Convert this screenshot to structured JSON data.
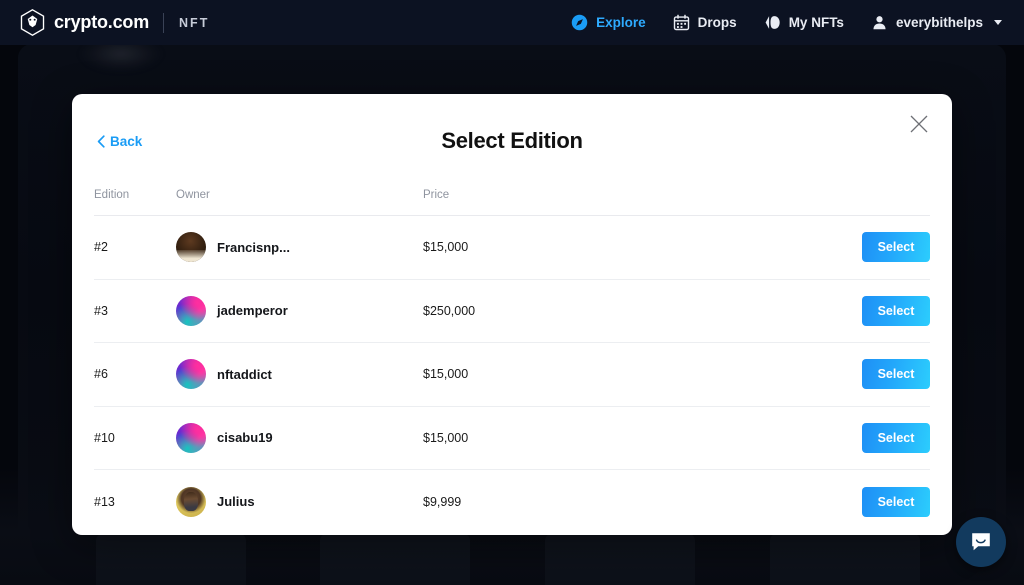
{
  "topnav": {
    "brand": {
      "name": "crypto.com",
      "sub": "NFT",
      "logo_icon": "crypto-com-logo-icon"
    },
    "items": [
      {
        "label": "Explore",
        "icon": "compass-icon",
        "active": true
      },
      {
        "label": "Drops",
        "icon": "calendar-icon",
        "active": false
      },
      {
        "label": "My NFTs",
        "icon": "cards-icon",
        "active": false
      }
    ],
    "user": {
      "label": "everybithelps",
      "icon": "person-icon",
      "caret": "chevron-down-icon"
    }
  },
  "modal": {
    "back_label": "Back",
    "back_icon": "chevron-left-icon",
    "title": "Select Edition",
    "close_icon": "close-icon",
    "columns": {
      "edition": "Edition",
      "owner": "Owner",
      "price": "Price"
    },
    "action_label": "Select",
    "rows": [
      {
        "edition": "#2",
        "owner": "Francisnp...",
        "price": "$15,000",
        "avatar": "photo-1",
        "action": "Select"
      },
      {
        "edition": "#3",
        "owner": "jademperor",
        "price": "$250,000",
        "avatar": "gradient",
        "action": "Select"
      },
      {
        "edition": "#6",
        "owner": "nftaddict",
        "price": "$15,000",
        "avatar": "gradient",
        "action": "Select"
      },
      {
        "edition": "#10",
        "owner": "cisabu19",
        "price": "$15,000",
        "avatar": "gradient",
        "action": "Select"
      },
      {
        "edition": "#13",
        "owner": "Julius",
        "price": "$9,999",
        "avatar": "photo-2",
        "action": "Select"
      }
    ]
  },
  "chat": {
    "icon": "chat-bubble-icon"
  },
  "colors": {
    "nav_bg": "#0c1222",
    "accent_blue": "#1a9cf5",
    "button_gradient_start": "#1e8ff5",
    "button_gradient_end": "#2ccdfd",
    "page_bg": "#04060c",
    "chat_bg": "#123a5e"
  }
}
